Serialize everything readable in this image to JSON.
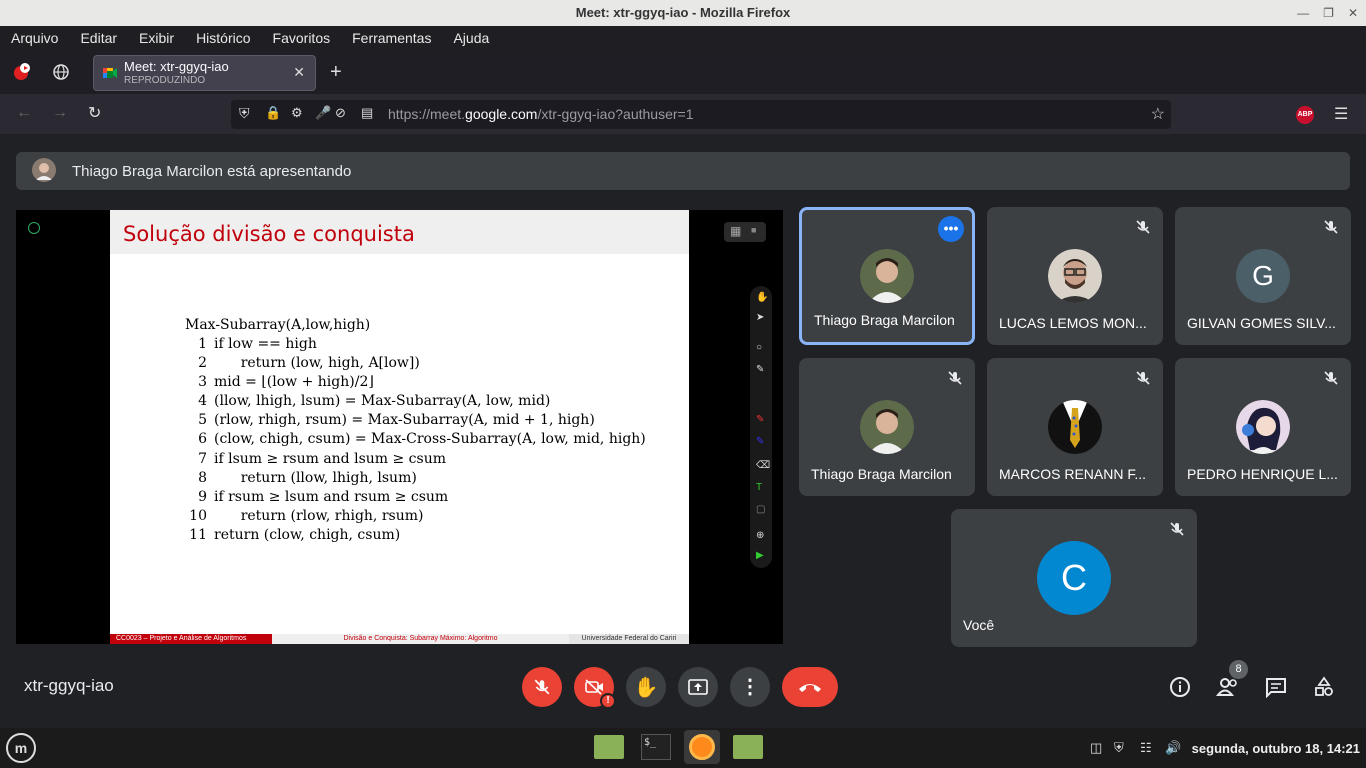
{
  "window": {
    "title": "Meet: xtr-ggyq-iao - Mozilla Firefox"
  },
  "menubar": [
    "Arquivo",
    "Editar",
    "Exibir",
    "Histórico",
    "Favoritos",
    "Ferramentas",
    "Ajuda"
  ],
  "tab": {
    "title": "Meet: xtr-ggyq-iao",
    "subtitle": "REPRODUZINDO"
  },
  "url": {
    "prefix": "https://meet.",
    "domain": "google.com",
    "path": "/xtr-ggyq-iao?authuser=1"
  },
  "meet": {
    "presenter_text": "Thiago Braga Marcilon está apresentando",
    "meeting_code": "xtr-ggyq-iao",
    "people_count": "8",
    "participants": [
      {
        "name": "Thiago Braga Marcilon",
        "avatar": "photo",
        "active": true
      },
      {
        "name": "LUCAS LEMOS MON...",
        "avatar": "photo"
      },
      {
        "name": "GILVAN GOMES SILV...",
        "avatar": "G"
      },
      {
        "name": "Thiago Braga Marcilon",
        "avatar": "photo"
      },
      {
        "name": "MARCOS RENANN F...",
        "avatar": "photo"
      },
      {
        "name": "PEDRO HENRIQUE L...",
        "avatar": "photo"
      },
      {
        "name": "Você",
        "avatar": "C"
      }
    ]
  },
  "slide": {
    "title": "Solução divisão e conquista",
    "algo_name": "Max-Subarray(A,low,high)",
    "lines": [
      {
        "n": "1",
        "t": "if low == high"
      },
      {
        "n": "2",
        "t": "      return (low, high, A[low])"
      },
      {
        "n": "3",
        "t": "mid = ⌊(low + high)/2⌋"
      },
      {
        "n": "4",
        "t": "(llow, lhigh, lsum) = Max-Subarray(A, low, mid)"
      },
      {
        "n": "5",
        "t": "(rlow, rhigh, rsum) = Max-Subarray(A, mid + 1, high)"
      },
      {
        "n": "6",
        "t": "(clow, chigh, csum) = Max-Cross-Subarray(A, low, mid, high)"
      },
      {
        "n": "7",
        "t": "if lsum ≥ rsum and lsum ≥ csum"
      },
      {
        "n": "8",
        "t": "      return (llow, lhigh, lsum)"
      },
      {
        "n": "9",
        "t": "if rsum ≥ lsum and rsum ≥ csum"
      },
      {
        "n": "10",
        "t": "      return (rlow, rhigh, rsum)"
      },
      {
        "n": "11",
        "t": "return (clow, chigh, csum)"
      }
    ],
    "footer_left": "CC0023 – Projeto e Análise de Algoritmos",
    "footer_mid": "Divisão e Conquista: Subarray Máximo: Algoritmo",
    "footer_right": "Universidade Federal do Cariri"
  },
  "taskbar": {
    "clock": "segunda, outubro 18, 14:21"
  },
  "colors": {
    "accent": "#8ab4f8",
    "danger": "#ea4335",
    "meet_bg": "#202124",
    "tile_bg": "#3c4043",
    "slide_red": "#c0000a"
  }
}
